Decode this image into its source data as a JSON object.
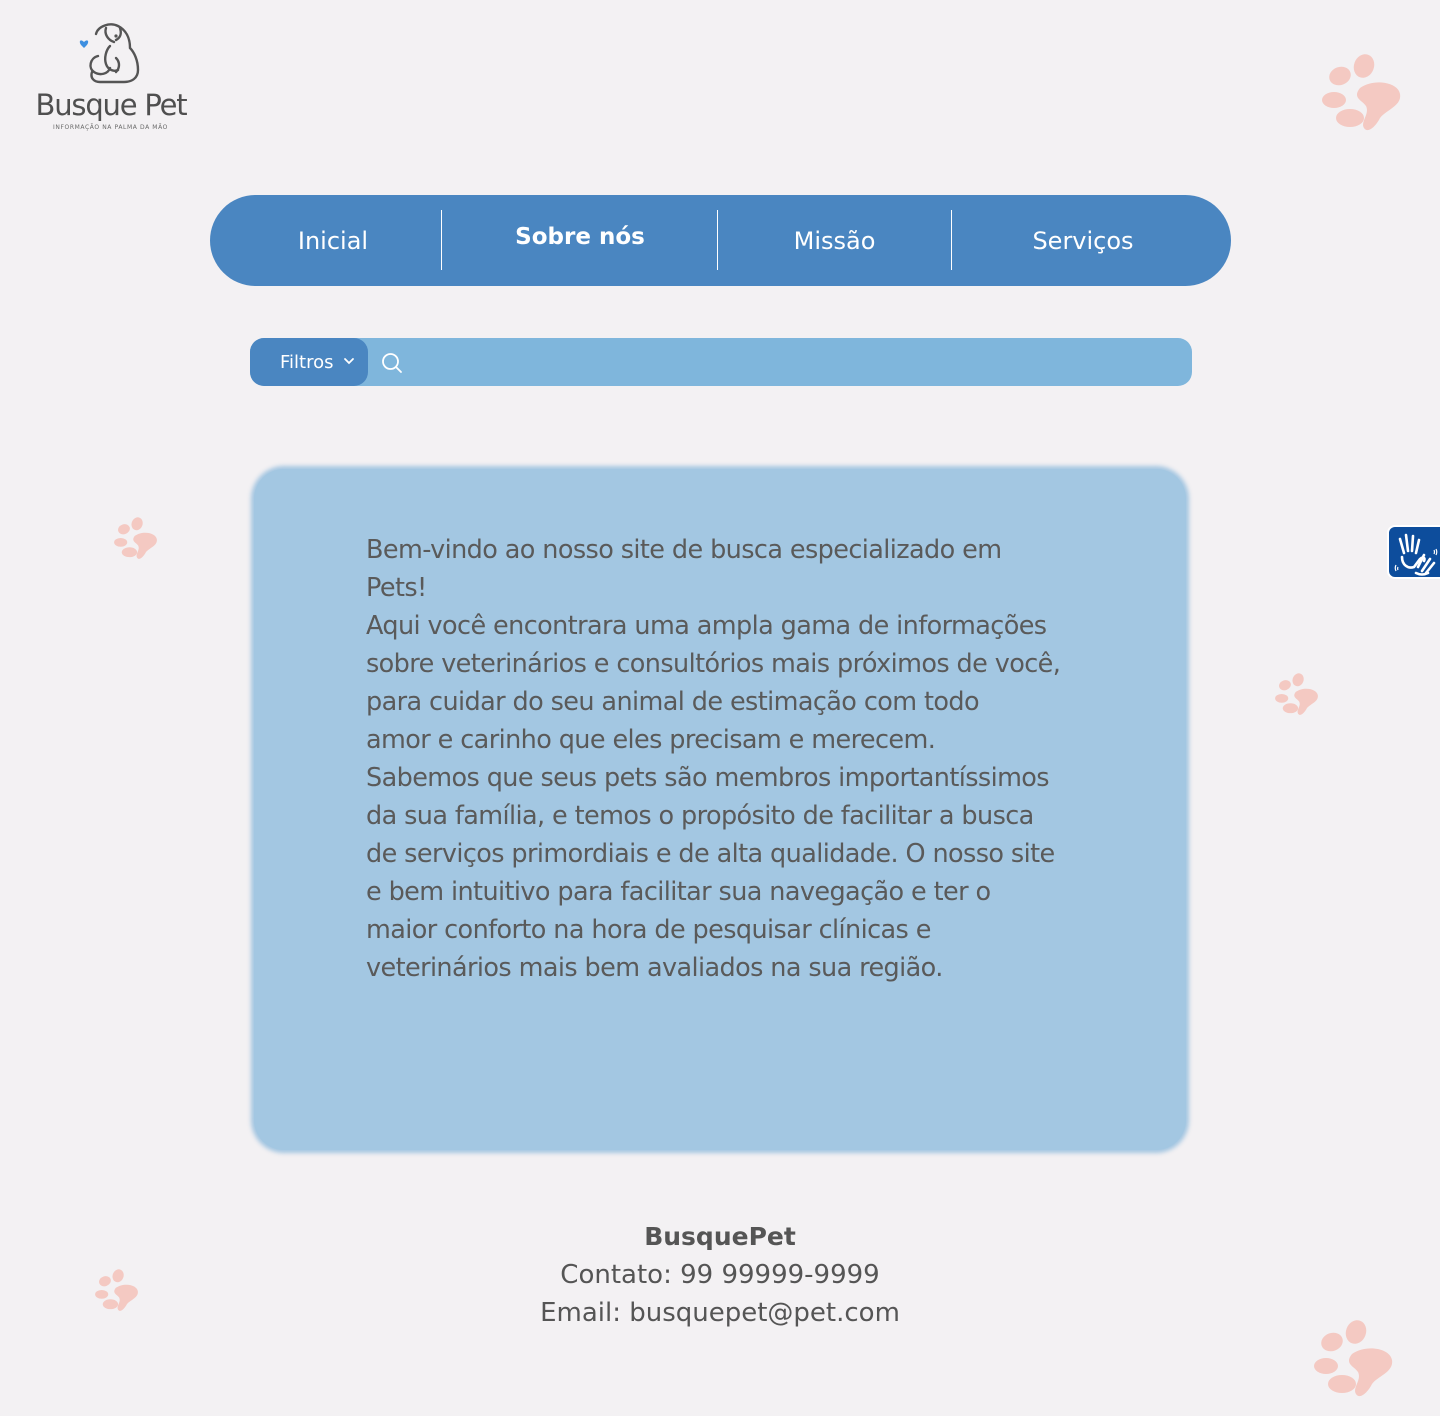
{
  "logo": {
    "name": "Busque Pet",
    "tagline": "INFORMAÇÃO NA PALMA DA MÃO",
    "heart_color": "#3d8fe0"
  },
  "nav": {
    "items": [
      {
        "label": "Inicial",
        "active": false
      },
      {
        "label": "Sobre nós",
        "active": true
      },
      {
        "label": "Missão",
        "active": false
      },
      {
        "label": "Serviços",
        "active": false
      }
    ],
    "color": "#4a86c1"
  },
  "search": {
    "filter_label": "Filtros",
    "placeholder": "",
    "icon": "search-icon",
    "bar_color": "#7fb6dc"
  },
  "content": {
    "paragraphs": [
      "Bem-vindo ao nosso site de busca especializado em\nPets!",
      "Aqui você encontrara uma ampla gama de informações\nsobre veterinários e consultórios mais próximos de você,\npara cuidar do seu animal de estimação com todo\namor e carinho que eles precisam e merecem.",
      "Sabemos que seus pets são membros importantíssimos\nda sua família, e temos o propósito de facilitar a busca\nde serviços primordiais e de alta qualidade. O nosso site\ne bem intuitivo para facilitar sua navegação e ter o\nmaior conforto na hora de pesquisar clínicas e\nveterinários mais bem avaliados na sua região."
    ],
    "card_color": "#a3c7e2"
  },
  "footer": {
    "brand": "BusquePet",
    "contact": "Contato: 99 99999-9999",
    "email": "Email: busquepet@pet.com"
  },
  "accessibility": {
    "icon": "sign-language-hands-icon",
    "color": "#0d4d9c"
  },
  "decor": {
    "paw_color": "#f4c9c2"
  }
}
